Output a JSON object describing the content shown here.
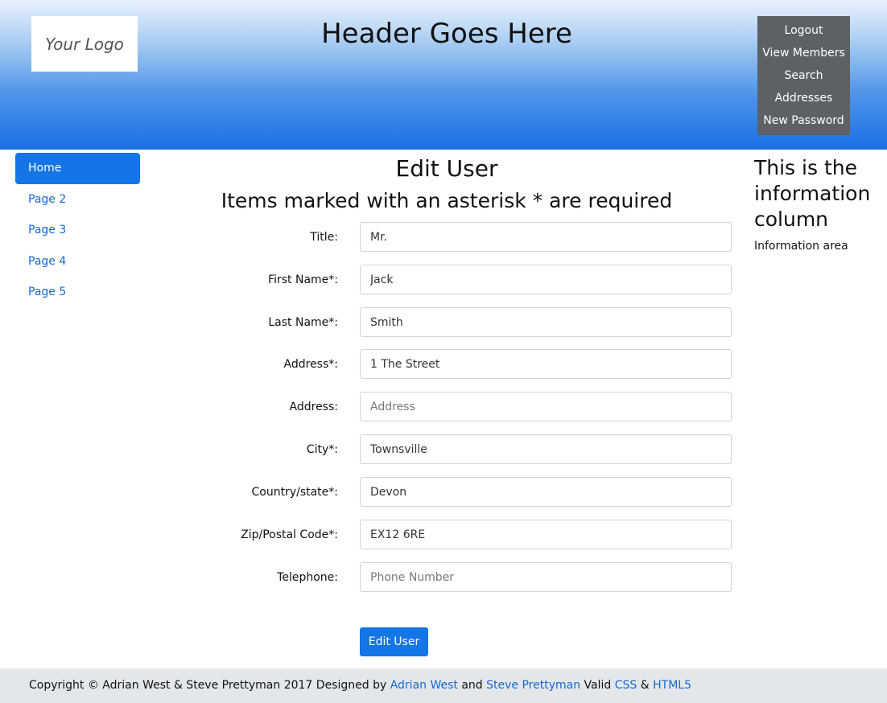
{
  "header": {
    "logo_text": "Your Logo",
    "title": "Header Goes Here",
    "nav": [
      "Logout",
      "View Members",
      "Search",
      "Addresses",
      "New Password"
    ]
  },
  "sidebar": {
    "items": [
      {
        "label": "Home",
        "active": true
      },
      {
        "label": "Page 2"
      },
      {
        "label": "Page 3"
      },
      {
        "label": "Page 4"
      },
      {
        "label": "Page 5"
      }
    ]
  },
  "main": {
    "title": "Edit User",
    "subtitle": "Items marked with an asterisk * are required",
    "fields": [
      {
        "label": "Title:",
        "value": "Mr.",
        "placeholder": ""
      },
      {
        "label": "First Name*:",
        "value": "Jack",
        "placeholder": ""
      },
      {
        "label": "Last Name*:",
        "value": "Smith",
        "placeholder": ""
      },
      {
        "label": "Address*:",
        "value": "1 The Street",
        "placeholder": ""
      },
      {
        "label": "Address:",
        "value": "",
        "placeholder": "Address"
      },
      {
        "label": "City*:",
        "value": "Townsville",
        "placeholder": ""
      },
      {
        "label": "Country/state*:",
        "value": "Devon",
        "placeholder": ""
      },
      {
        "label": "Zip/Postal Code*:",
        "value": "EX12 6RE",
        "placeholder": ""
      },
      {
        "label": "Telephone:",
        "value": "",
        "placeholder": "Phone Number"
      }
    ],
    "submit_label": "Edit User"
  },
  "info": {
    "title": "This is the information column",
    "text": "Information area"
  },
  "footer": {
    "prefix": "Copyright © Adrian West & Steve Prettyman 2017 Designed by",
    "link1": "Adrian West",
    "and": "and",
    "link2": "Steve Prettyman",
    "valid": "Valid",
    "css": "CSS",
    "amp": "&",
    "html5": "HTML5"
  },
  "colors": {
    "accent": "#1475e8",
    "nav_bg": "#5d6165",
    "footer_bg": "#e4e7ea"
  }
}
